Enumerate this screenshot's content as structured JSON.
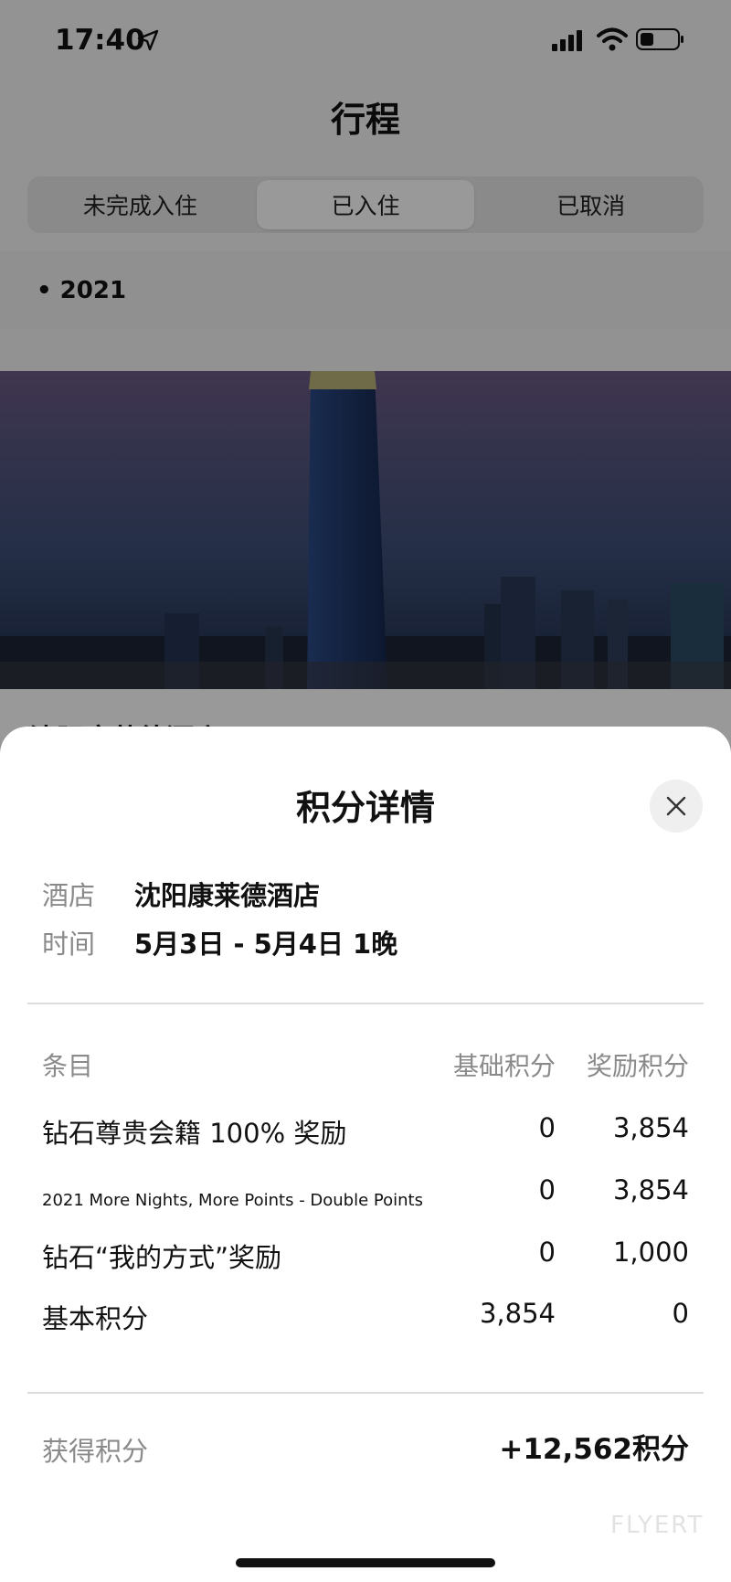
{
  "status_bar": {
    "time": "17:40",
    "icons": [
      "location-arrow-icon",
      "signal-icon",
      "wifi-icon",
      "battery-icon"
    ]
  },
  "header": {
    "title": "行程"
  },
  "tabs": [
    {
      "label": "未完成入住",
      "active": false
    },
    {
      "label": "已入住",
      "active": true
    },
    {
      "label": "已取消",
      "active": false
    }
  ],
  "year_section": {
    "label": "• 2021"
  },
  "hotel_card": {
    "name": "沈阳康莱德酒店"
  },
  "sheet": {
    "title": "积分详情",
    "close_icon": "close-icon",
    "hotel_label": "酒店",
    "hotel_value": "沈阳康莱德酒店",
    "time_label": "时间",
    "time_value": "5月3日 - 5月4日 1晚",
    "table": {
      "headers": {
        "item": "条目",
        "base": "基础积分",
        "bonus": "奖励积分"
      },
      "rows": [
        {
          "label": "钻石尊贵会籍 100% 奖励",
          "base": "0",
          "bonus": "3,854"
        },
        {
          "label": "2021 More Nights, More Points - Double Points",
          "base": "0",
          "bonus": "3,854"
        },
        {
          "label": "钻石“我的方式”奖励",
          "base": "0",
          "bonus": "1,000"
        },
        {
          "label": "基本积分",
          "base": "3,854",
          "bonus": "0"
        }
      ]
    },
    "total_label": "获得积分",
    "total_value": "+12,562积分"
  },
  "watermark": "FLYERT",
  "colors": {
    "overlay": "#000000",
    "sheet_bg": "#ffffff",
    "muted_text": "#8a8a8a"
  }
}
